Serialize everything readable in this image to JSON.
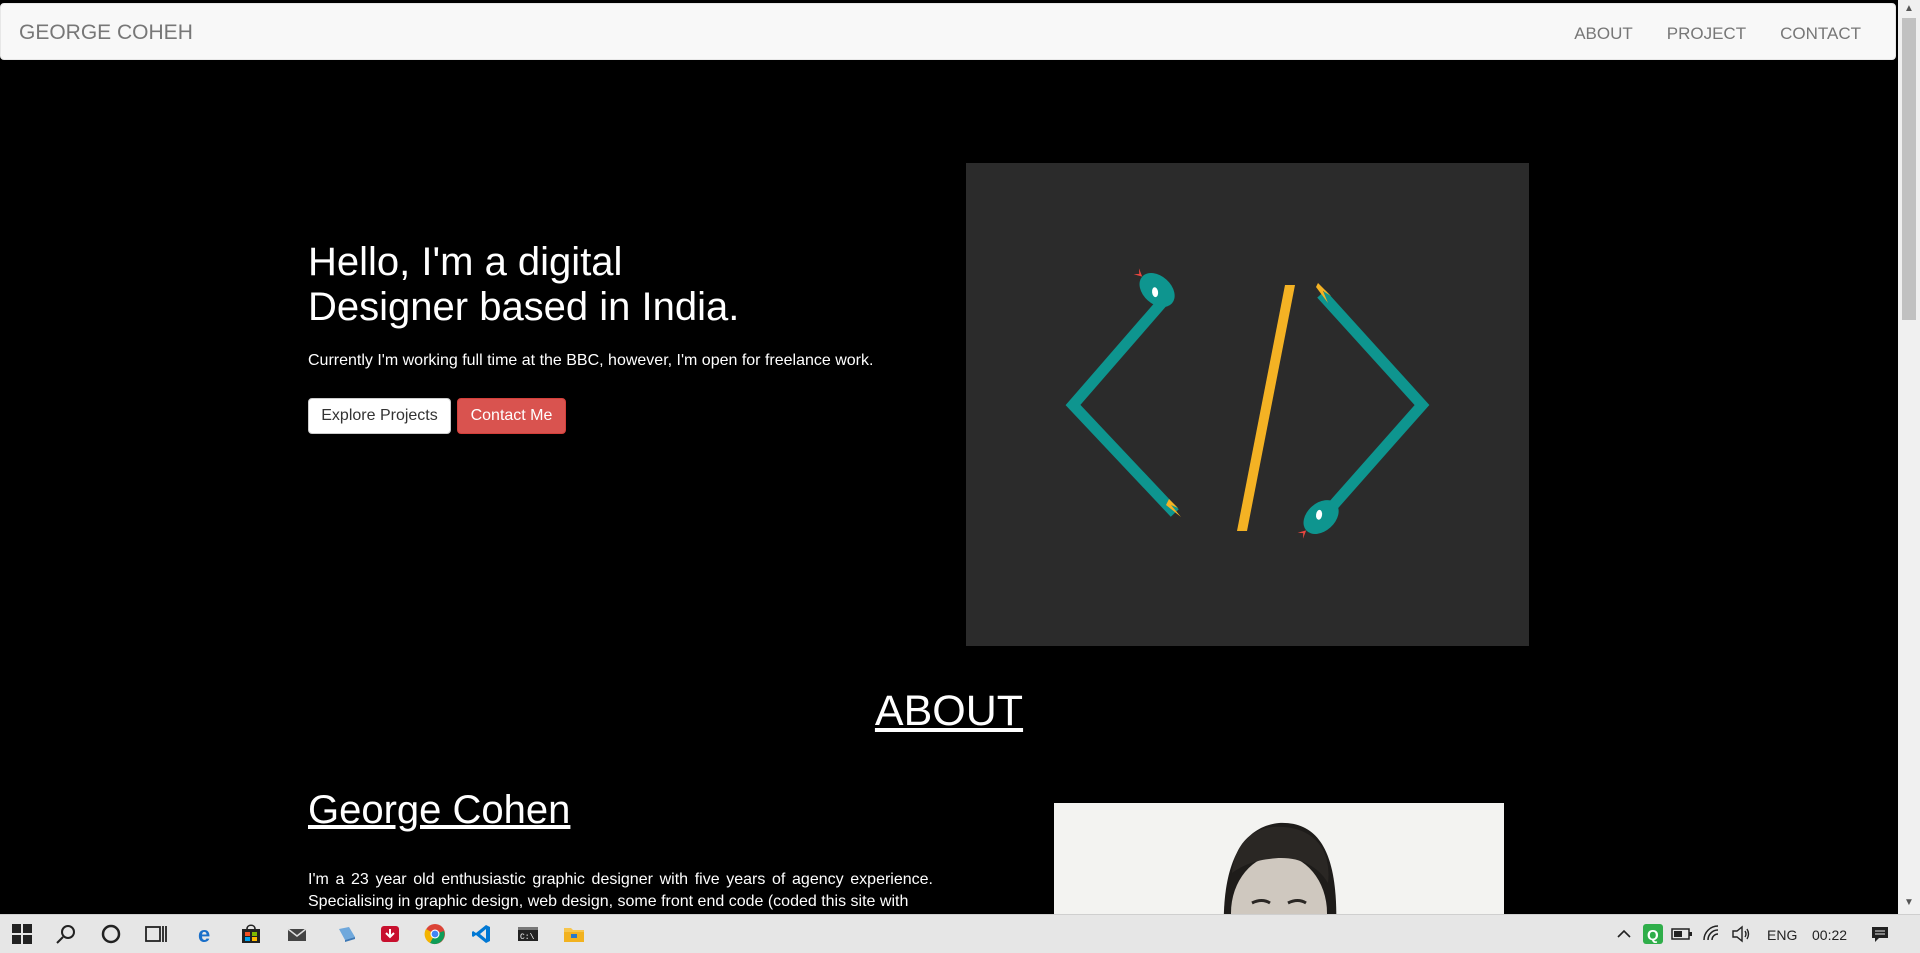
{
  "navbar": {
    "brand": "GEORGE COHEH",
    "links": [
      "ABOUT",
      "PROJECT",
      "CONTACT"
    ]
  },
  "hero": {
    "title_line1": "Hello, I'm a digital",
    "title_line2": "Designer based in India.",
    "subtitle": "Currently I'm working full time at the BBC, however, I'm open for freelance work.",
    "explore_button": "Explore Projects",
    "contact_button": "Contact Me",
    "illustration_icon": "code-brackets-illustration"
  },
  "about": {
    "heading": "ABOUT",
    "name": "George Cohen",
    "text": "I'm a 23 year old enthusiastic graphic designer with five years of agency experience. Specialising in graphic design, web design, some front end code (coded this site with",
    "photo_icon": "portrait-photo"
  },
  "taskbar": {
    "language": "ENG",
    "time": "00:22",
    "icons": [
      "windows-start-icon",
      "search-icon",
      "cortana-icon",
      "task-view-icon",
      "edge-icon",
      "store-icon",
      "mail-icon",
      "app-icon",
      "download-app-icon",
      "chrome-icon",
      "vscode-icon",
      "terminal-icon",
      "file-explorer-icon"
    ]
  },
  "colors": {
    "background": "#000000",
    "navbar_bg": "#f8f8f8",
    "contact_btn": "#d9534f",
    "art_bg": "#2b2b2b",
    "teal": "#0e958f",
    "yellow": "#f4b224"
  }
}
